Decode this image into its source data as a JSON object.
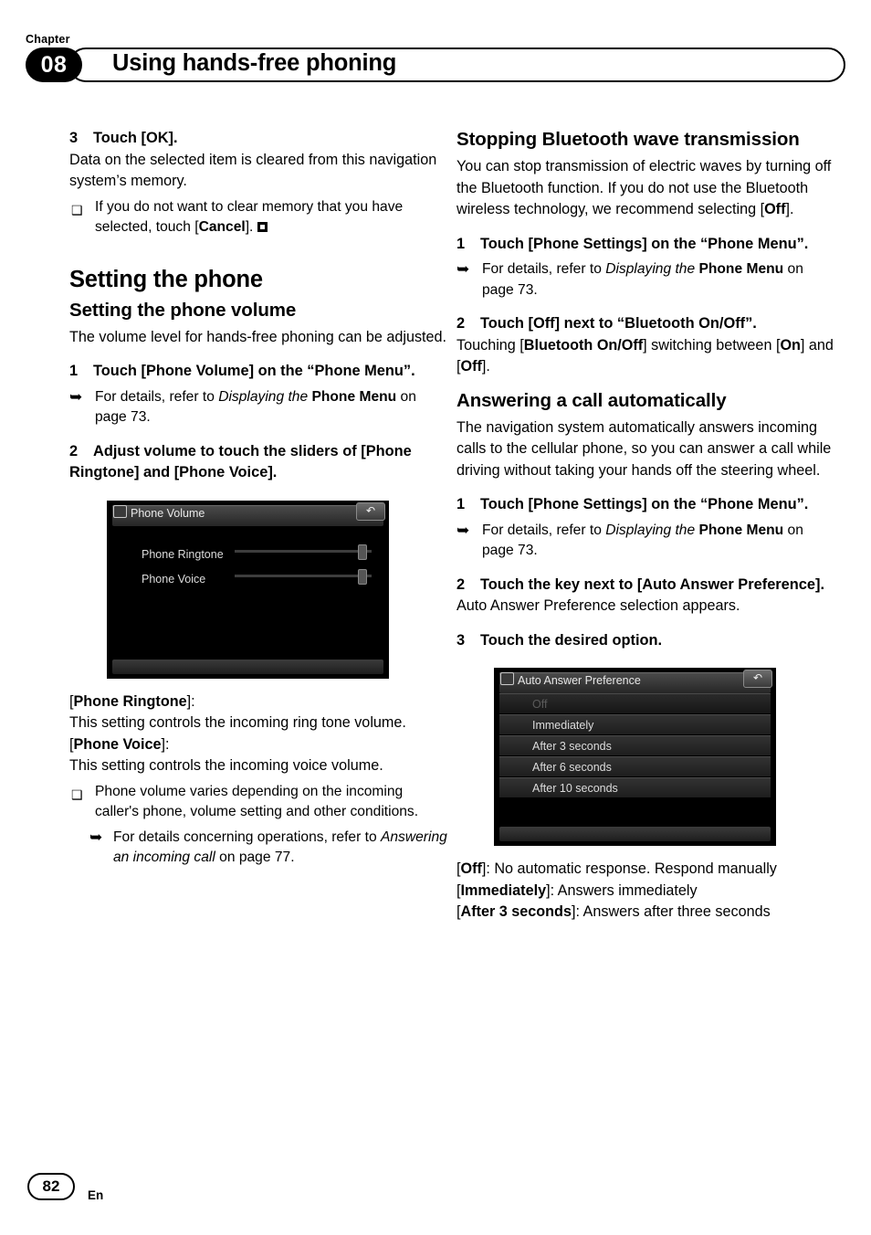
{
  "header": {
    "chapter_word": "Chapter",
    "chapter_number": "08",
    "title": "Using hands-free phoning"
  },
  "left_column": {
    "step3_label": "3",
    "step3_text": "Touch [OK].",
    "step3_body": "Data on the selected item is cleared from this navigation system’s memory.",
    "note1_prefix": "If you do not want to clear memory that you have selected, touch [",
    "note1_bold": "Cancel",
    "note1_suffix": "].",
    "heading_setting_phone": "Setting the phone",
    "heading_phone_volume": "Setting the phone volume",
    "volume_intro": "The volume level for hands-free phoning can be adjusted.",
    "step1_label": "1",
    "step1_text": "Touch [Phone Volume] on the “Phone Menu”.",
    "step1_note_prefix": "For details, refer to ",
    "step1_note_italic": "Displaying the ",
    "step1_note_bold": "Phone Menu",
    "step1_note_suffix": " on page 73.",
    "step2_label": "2",
    "step2_text": "Adjust volume to touch the sliders of [Phone Ringtone] and [Phone Voice].",
    "figure_volume": {
      "title": "Phone Volume",
      "title_icon": "phone-icon",
      "back_icon": "back-arrow-icon",
      "rows": [
        "Phone Ringtone",
        "Phone Voice"
      ]
    },
    "ringtone_label": "Phone Ringtone",
    "ringtone_desc": "This setting controls the incoming ring tone volume.",
    "voice_label": "Phone Voice",
    "voice_desc": "This setting controls the incoming voice volume.",
    "note2": "Phone volume varies depending on the incoming caller's phone, volume setting and other conditions.",
    "note3_prefix": "For details concerning operations, refer to ",
    "note3_italic": "Answering an incoming call",
    "note3_suffix": " on page 77."
  },
  "right_column": {
    "heading_stopping": "Stopping Bluetooth wave transmission",
    "stopping_intro_a": "You can stop transmission of electric waves by turning off the Bluetooth function. If you do not use the Bluetooth wireless technology, we recommend selecting [",
    "stopping_intro_bold": "Off",
    "stopping_intro_b": "].",
    "step1_label": "1",
    "step1_text": "Touch [Phone Settings] on the “Phone Menu”.",
    "step1_note_prefix": "For details, refer to ",
    "step1_note_italic": "Displaying the ",
    "step1_note_bold": "Phone Menu",
    "step1_note_suffix": " on page 73.",
    "step2_label": "2",
    "step2_text": "Touch [Off] next to “Bluetooth On/Off”.",
    "step2_body_a": "Touching [",
    "step2_body_bold1": "Bluetooth On/Off",
    "step2_body_b": "] switching between [",
    "step2_body_bold2": "On",
    "step2_body_c": "] and [",
    "step2_body_bold3": "Off",
    "step2_body_d": "].",
    "heading_answering": "Answering a call automatically",
    "answering_intro": "The navigation system automatically answers incoming calls to the cellular phone, so you can answer a call while driving without taking your hands off the steering wheel.",
    "a_step1_label": "1",
    "a_step1_text": "Touch [Phone Settings] on the “Phone Menu”.",
    "a_step1_note_prefix": "For details, refer to ",
    "a_step1_note_italic": "Displaying the ",
    "a_step1_note_bold": "Phone Menu",
    "a_step1_note_suffix": " on page 73.",
    "a_step2_label": "2",
    "a_step2_text": "Touch the key next to [Auto Answer Preference].",
    "a_step2_body": "Auto Answer Preference selection appears.",
    "a_step3_label": "3",
    "a_step3_text": "Touch the desired option.",
    "figure_auto": {
      "title": "Auto Answer Preference",
      "title_icon": "phone-icon",
      "back_icon": "back-arrow-icon",
      "items": [
        "Off",
        "Immediately",
        "After 3 seconds",
        "After 6 seconds",
        "After 10 seconds"
      ]
    },
    "opt_off_label": "Off",
    "opt_off_desc": "]: No automatic response. Respond manually",
    "opt_imm_label": "Immediately",
    "opt_imm_desc": "]: Answers immediately",
    "opt_a3_label": "After 3 seconds",
    "opt_a3_desc": "]: Answers after three seconds"
  },
  "footer": {
    "page_number": "82",
    "language": "En"
  }
}
